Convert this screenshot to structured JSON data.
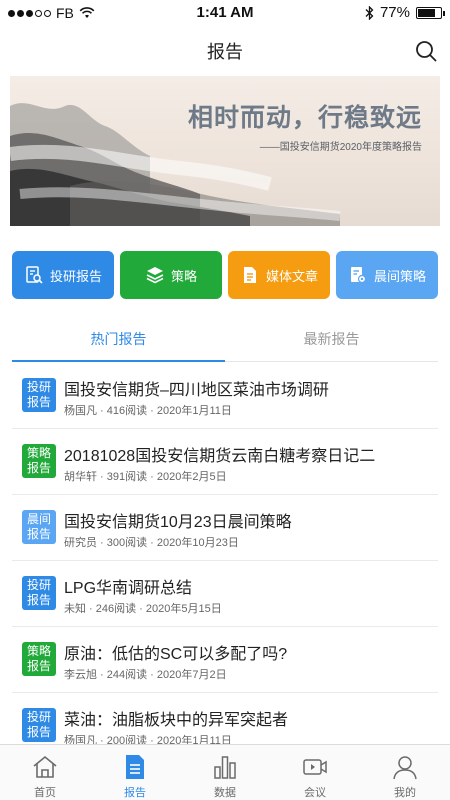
{
  "status_bar": {
    "carrier": "FB",
    "time": "1:41 AM",
    "battery": "77%",
    "battery_level": 0.77
  },
  "nav": {
    "title": "报告",
    "search_icon": "search-icon"
  },
  "banner": {
    "title": "相时而动，行稳致远",
    "subtitle": "——国投安信期货2020年度策略报告"
  },
  "quick_actions": [
    {
      "label": "投研报告",
      "icon": "report-search-icon",
      "color": "#2f8ae6"
    },
    {
      "label": "策略",
      "icon": "layers-icon",
      "color": "#21a93a"
    },
    {
      "label": "媒体文章",
      "icon": "document-icon",
      "color": "#f59c11"
    },
    {
      "label": "晨间策略",
      "icon": "morning-report-icon",
      "color": "#5aa6f3"
    }
  ],
  "tabs": [
    {
      "label": "热门报告",
      "active": true
    },
    {
      "label": "最新报告",
      "active": false
    }
  ],
  "reports": [
    {
      "badge": "投研\n报告",
      "badge_color": "#2f8ae6",
      "title": "国投安信期货–四川地区菜油市场调研",
      "meta": "杨国凡 · 416阅读 · 2020年1月11日"
    },
    {
      "badge": "策略\n报告",
      "badge_color": "#21a93a",
      "title": "20181028国投安信期货云南白糖考察日记二",
      "meta": "胡华轩 · 391阅读 · 2020年2月5日"
    },
    {
      "badge": "晨间\n报告",
      "badge_color": "#5aa6f3",
      "title": "国投安信期货10月23日晨间策略",
      "meta": "研究员 · 300阅读 · 2020年10月23日"
    },
    {
      "badge": "投研\n报告",
      "badge_color": "#2f8ae6",
      "title": "LPG华南调研总结",
      "meta": "未知 · 246阅读 · 2020年5月15日"
    },
    {
      "badge": "策略\n报告",
      "badge_color": "#21a93a",
      "title": "原油：低估的SC可以多配了吗?",
      "meta": "李云旭 · 244阅读 · 2020年7月2日"
    },
    {
      "badge": "投研\n报告",
      "badge_color": "#2f8ae6",
      "title": "菜油：油脂板块中的异军突起者",
      "meta": "杨国凡 · 200阅读 · 2020年1月11日"
    }
  ],
  "tab_bar": [
    {
      "label": "首页",
      "icon": "home-icon",
      "active": false
    },
    {
      "label": "报告",
      "icon": "report-icon",
      "active": true
    },
    {
      "label": "数据",
      "icon": "chart-icon",
      "active": false
    },
    {
      "label": "会议",
      "icon": "video-icon",
      "active": false
    },
    {
      "label": "我的",
      "icon": "user-icon",
      "active": false
    }
  ]
}
